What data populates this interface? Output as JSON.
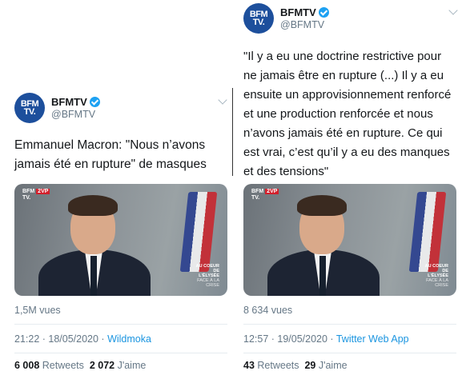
{
  "tweets": [
    {
      "account": {
        "avatar_line1": "BFM",
        "avatar_line2": "TV.",
        "display_name": "BFMTV",
        "handle": "@BFMTV"
      },
      "text": "Emmanuel Macron: \"Nous n’avons jamais été en rupture\" de masques",
      "media": {
        "logo": "BFM",
        "logo_tag": "2VP",
        "logo_line2": "TV.",
        "corner_title": "AU COEUR DE L'ÉLYSÉE",
        "corner_sub": "FACE À LA CRISE"
      },
      "views": "1,5M vues",
      "timestamp": "21:22 · 18/05/2020 · ",
      "source": "Wildmoka",
      "retweets_count": "6 008",
      "retweets_label": "Retweets",
      "likes_count": "2 072",
      "likes_label": "J'aime"
    },
    {
      "account": {
        "avatar_line1": "BFM",
        "avatar_line2": "TV.",
        "display_name": "BFMTV",
        "handle": "@BFMTV"
      },
      "text": "\"Il y a eu une doctrine restrictive pour ne jamais être en rupture (...) Il y a eu ensuite un approvisionnement renforcé et une production renforcée et nous n’avons jamais été en rupture. Ce qui est vrai, c’est qu’il y a eu des manques et des tensions\"",
      "media": {
        "logo": "BFM",
        "logo_tag": "2VP",
        "logo_line2": "TV.",
        "corner_title": "AU COEUR DE L'ÉLYSÉE",
        "corner_sub": "FACE À LA CRISE"
      },
      "views": "8 634 vues",
      "timestamp": "12:57 · 19/05/2020 · ",
      "source": "Twitter Web App",
      "retweets_count": "43",
      "retweets_label": "Retweets",
      "likes_count": "29",
      "likes_label": "J'aime"
    }
  ],
  "colors": {
    "brand": "#1d4f9c",
    "verified": "#1da1f2",
    "link": "#1b95e0",
    "muted": "#657786"
  },
  "icons": {
    "verified": "verified-badge-icon",
    "menu": "chevron-down-icon"
  }
}
